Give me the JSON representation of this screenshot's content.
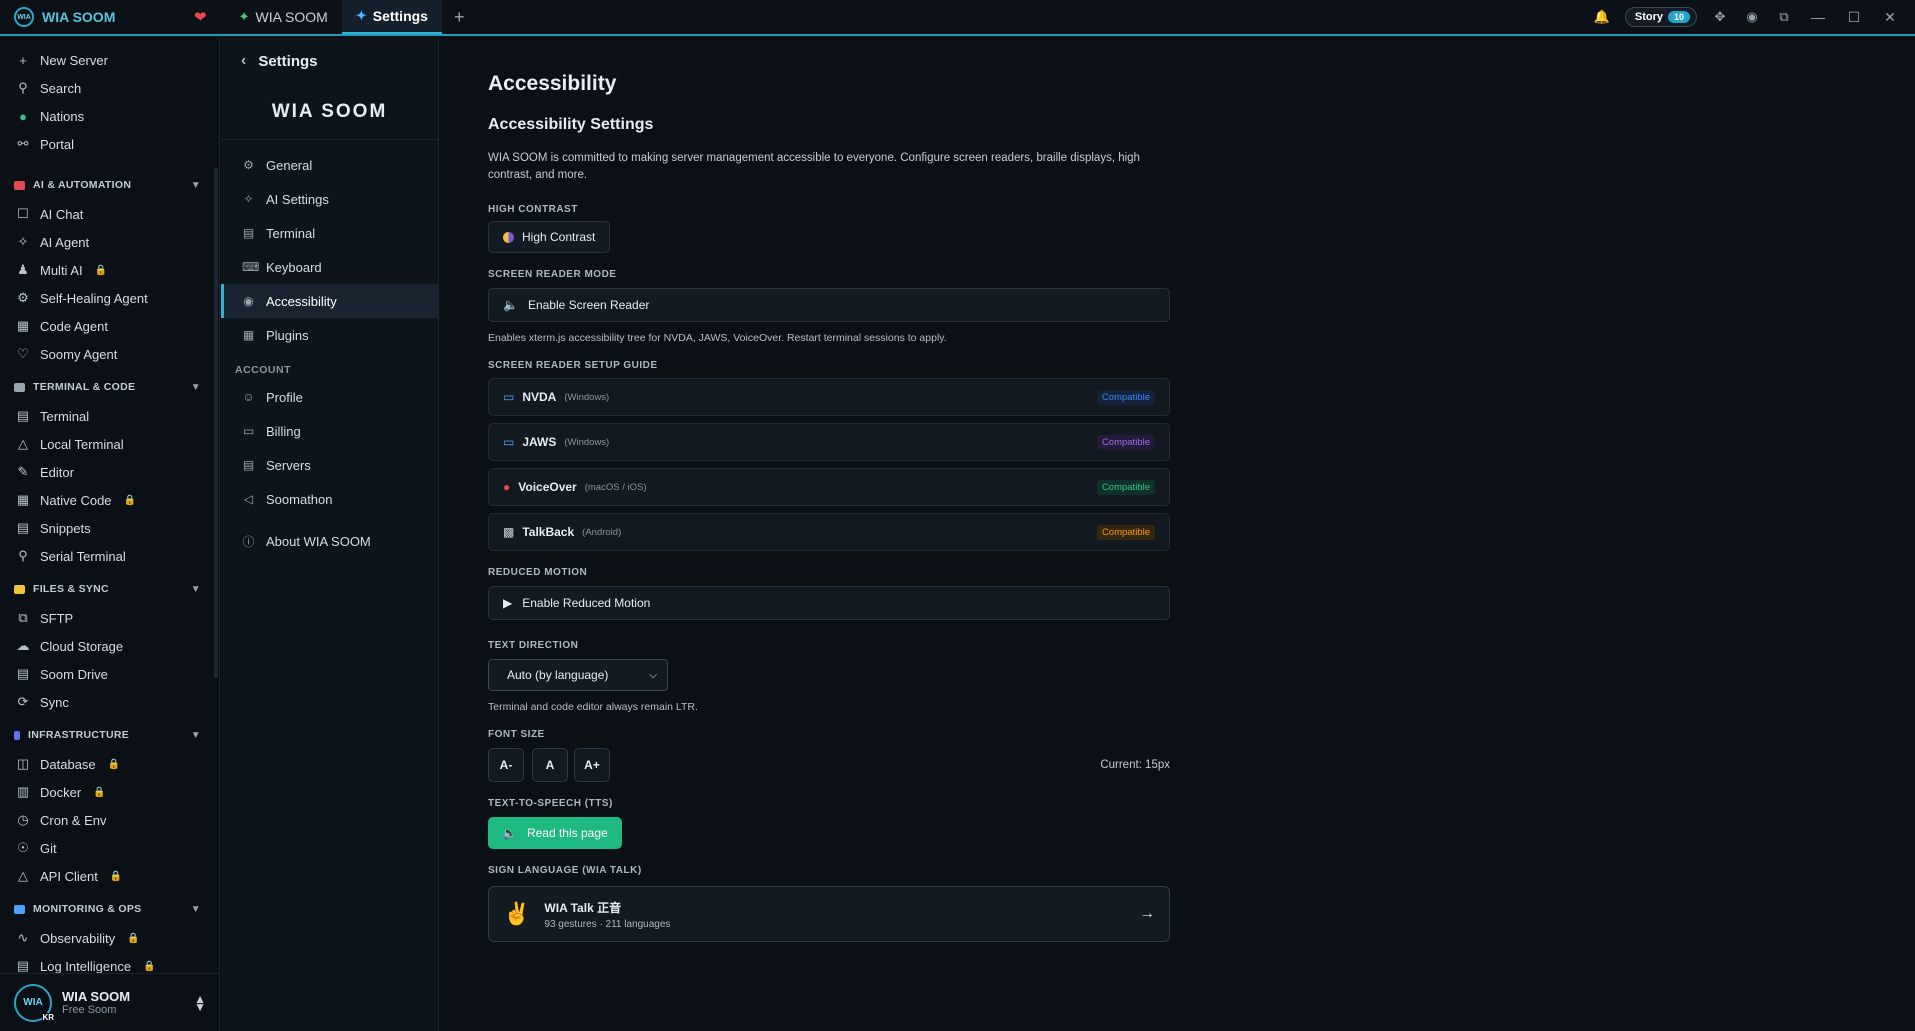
{
  "titlebar": {
    "brand": "WIA SOOM",
    "logo_text": "WIA",
    "tabs": [
      {
        "label": "WIA SOOM",
        "active": false
      },
      {
        "label": "Settings",
        "active": true
      }
    ],
    "story_label": "Story",
    "story_count": "10"
  },
  "sidebar": {
    "top": [
      {
        "label": "New Server",
        "icon": "plus-icon"
      },
      {
        "label": "Search",
        "icon": "search-icon"
      },
      {
        "label": "Nations",
        "icon": "globe-color-icon"
      },
      {
        "label": "Portal",
        "icon": "globe-icon"
      }
    ],
    "sections": [
      {
        "title": "AI & AUTOMATION",
        "color": "#e5484d",
        "items": [
          {
            "label": "AI Chat",
            "locked": false
          },
          {
            "label": "AI Agent",
            "locked": false
          },
          {
            "label": "Multi AI",
            "locked": true
          },
          {
            "label": "Self-Healing Agent",
            "locked": false
          },
          {
            "label": "Code Agent",
            "locked": false
          },
          {
            "label": "Soomy Agent",
            "locked": false
          }
        ]
      },
      {
        "title": "TERMINAL & CODE",
        "color": "#9aa4ae",
        "items": [
          {
            "label": "Terminal",
            "locked": false
          },
          {
            "label": "Local Terminal",
            "locked": false
          },
          {
            "label": "Editor",
            "locked": false
          },
          {
            "label": "Native Code",
            "locked": true
          },
          {
            "label": "Snippets",
            "locked": false
          },
          {
            "label": "Serial Terminal",
            "locked": false
          }
        ]
      },
      {
        "title": "FILES & SYNC",
        "color": "#f0c23a",
        "items": [
          {
            "label": "SFTP",
            "locked": false
          },
          {
            "label": "Cloud Storage",
            "locked": false
          },
          {
            "label": "Soom Drive",
            "locked": false
          },
          {
            "label": "Sync",
            "locked": false
          }
        ]
      },
      {
        "title": "INFRASTRUCTURE",
        "color": "#6a6ff0",
        "items": [
          {
            "label": "Database",
            "locked": true
          },
          {
            "label": "Docker",
            "locked": true
          },
          {
            "label": "Cron & Env",
            "locked": false
          },
          {
            "label": "Git",
            "locked": false
          },
          {
            "label": "API Client",
            "locked": true
          }
        ]
      },
      {
        "title": "MONITORING & OPS",
        "color": "#4da3ff",
        "items": [
          {
            "label": "Observability",
            "locked": true
          },
          {
            "label": "Log Intelligence",
            "locked": true
          }
        ]
      }
    ],
    "user": {
      "name": "WIA SOOM",
      "plan": "Free Soom",
      "avatar_text": "WIA",
      "avatar_badge": "KR"
    }
  },
  "settings_nav": {
    "title": "Settings",
    "brand": "WIA SOOM",
    "items": [
      {
        "label": "General",
        "icon": "gear-icon",
        "active": false
      },
      {
        "label": "AI Settings",
        "icon": "sparkle-icon",
        "active": false
      },
      {
        "label": "Terminal",
        "icon": "terminal-icon",
        "active": false
      },
      {
        "label": "Keyboard",
        "icon": "keyboard-icon",
        "active": false
      },
      {
        "label": "Accessibility",
        "icon": "eye-icon",
        "active": true
      },
      {
        "label": "Plugins",
        "icon": "plugin-icon",
        "active": false
      }
    ],
    "account_group": "ACCOUNT",
    "account_items": [
      {
        "label": "Profile",
        "icon": "user-icon"
      },
      {
        "label": "Billing",
        "icon": "card-icon"
      },
      {
        "label": "Servers",
        "icon": "server-icon"
      },
      {
        "label": "Soomathon",
        "icon": "megaphone-icon"
      }
    ],
    "about": "About WIA SOOM"
  },
  "main": {
    "title": "Accessibility",
    "subtitle": "Accessibility Settings",
    "description": "WIA SOOM is committed to making server management accessible to everyone. Configure screen readers, braille displays, high contrast, and more.",
    "high_contrast": {
      "label": "HIGH CONTRAST",
      "button": "High Contrast"
    },
    "screen_reader": {
      "label": "SCREEN READER MODE",
      "button": "Enable Screen Reader",
      "hint": "Enables xterm.js accessibility tree for NVDA, JAWS, VoiceOver. Restart terminal sessions to apply."
    },
    "guide": {
      "label": "SCREEN READER SETUP GUIDE",
      "items": [
        {
          "name": "NVDA",
          "platform": "(Windows)",
          "status": "Compatible",
          "color": "#3b82f6",
          "bg": "#14233a",
          "icon": "monitor-icon"
        },
        {
          "name": "JAWS",
          "platform": "(Windows)",
          "status": "Compatible",
          "color": "#9d6cf0",
          "bg": "#231a38",
          "icon": "monitor-icon"
        },
        {
          "name": "VoiceOver",
          "platform": "(macOS / iOS)",
          "status": "Compatible",
          "color": "#2fc48a",
          "bg": "#12302a",
          "icon": "apple-icon"
        },
        {
          "name": "TalkBack",
          "platform": "(Android)",
          "status": "Compatible",
          "color": "#f59e0b",
          "bg": "#35270f",
          "icon": "robot-icon"
        }
      ]
    },
    "reduced_motion": {
      "label": "REDUCED MOTION",
      "button": "Enable Reduced Motion"
    },
    "text_direction": {
      "label": "TEXT DIRECTION",
      "selected": "Auto (by language)",
      "hint": "Terminal and code editor always remain LTR."
    },
    "font_size": {
      "label": "FONT SIZE",
      "decrease": "A-",
      "reset": "A",
      "increase": "A+",
      "current": "Current: 15px"
    },
    "tts": {
      "label": "TEXT-TO-SPEECH (TTS)",
      "button": "Read this page"
    },
    "sign_language": {
      "label": "SIGN LANGUAGE (WIA TALK)",
      "title": "WIA Talk 正音",
      "subtitle": "93 gestures · 211 languages"
    }
  }
}
